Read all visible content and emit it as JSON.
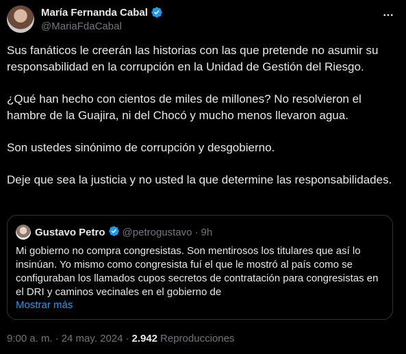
{
  "author": {
    "name": "María Fernanda Cabal",
    "handle": "@MariaFdaCabal",
    "verified_icon": "verified-badge-icon",
    "accent": "#1d9bf0"
  },
  "tweet": {
    "paragraphs": [
      "Sus fanáticos le creerán las historias con las que pretende no asumir su responsabilidad en la corrupción en la Unidad de Gestión del Riesgo.",
      "¿Qué han hecho con cientos de miles de millones? No resolvieron el hambre de la Guajira, ni del Chocó y mucho menos llevaron agua.",
      "Son ustedes sinónimo de corrupción y desgobierno.",
      "Deje que sea la justicia y no usted la que determine las responsabilidades."
    ]
  },
  "quoted": {
    "name": "Gustavo Petro",
    "handle": "@petrogustavo",
    "separator": "·",
    "time": "9h",
    "text": "Mi gobierno no compra congresistas. Son mentirosos los titulares que así lo insinúan. Yo mismo como congresista fuí el que le mostró al país como se configuraban los llamados cupos secretos de contratación para congresistas en el DRI y caminos vecinales en el gobierno de",
    "show_more": "Mostrar más"
  },
  "meta": {
    "time": "9:00 a. m.",
    "separator": "·",
    "date": "24 may. 2024",
    "separator2": "·",
    "views": "2.942",
    "views_label": "Reproducciones"
  },
  "colors": {
    "background": "#000000",
    "text": "#e7e9ea",
    "muted": "#71767b",
    "link": "#1d9bf0",
    "border": "#2f3336"
  }
}
